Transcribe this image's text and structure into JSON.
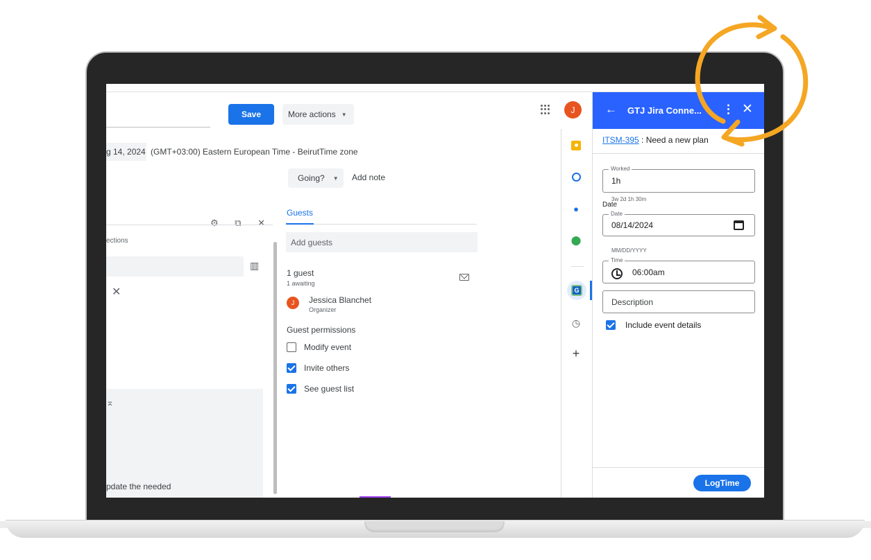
{
  "calendar": {
    "save_label": "Save",
    "more_actions_label": "More actions",
    "date_partial": "g 14, 2024",
    "timezone_text": "(GMT+03:00) Eastern European Time - Beirut",
    "timezone_link": "Time zone",
    "going_label": "Going?",
    "add_note_label": "Add note",
    "sections_partial": "ections",
    "description_partial": "pdate the needed"
  },
  "guests": {
    "tab_label": "Guests",
    "add_placeholder": "Add guests",
    "count": "1 guest",
    "awaiting": "1 awaiting",
    "organizer": {
      "initial": "J",
      "name": "Jessica Blanchet",
      "role": "Organizer"
    },
    "permissions_title": "Guest permissions",
    "permissions": [
      {
        "label": "Modify event",
        "checked": false
      },
      {
        "label": "Invite others",
        "checked": true
      },
      {
        "label": "See guest list",
        "checked": true
      }
    ]
  },
  "topbar": {
    "user_initial": "J"
  },
  "panel": {
    "title": "GTJ Jira Conne...",
    "issue_key": "ITSM-395",
    "issue_summary": ": Need a new plan",
    "worked_legend": "Worked",
    "worked_value": "1h",
    "worked_hint": "3w 2d 1h 30m",
    "date_section_label": "Date",
    "date_legend": "Date",
    "date_value": "08/14/2024",
    "date_hint": "MM/DD/YYYY",
    "time_legend": "Time",
    "time_value": "06:00am",
    "description_placeholder": "Description",
    "include_label": "Include event details",
    "include_checked": true,
    "logtime_label": "LogTime"
  },
  "colors": {
    "panel_header": "#2962ff",
    "primary_blue": "#1a73e8",
    "avatar_orange": "#e8541f",
    "refresh_arrow": "#f5a623"
  }
}
